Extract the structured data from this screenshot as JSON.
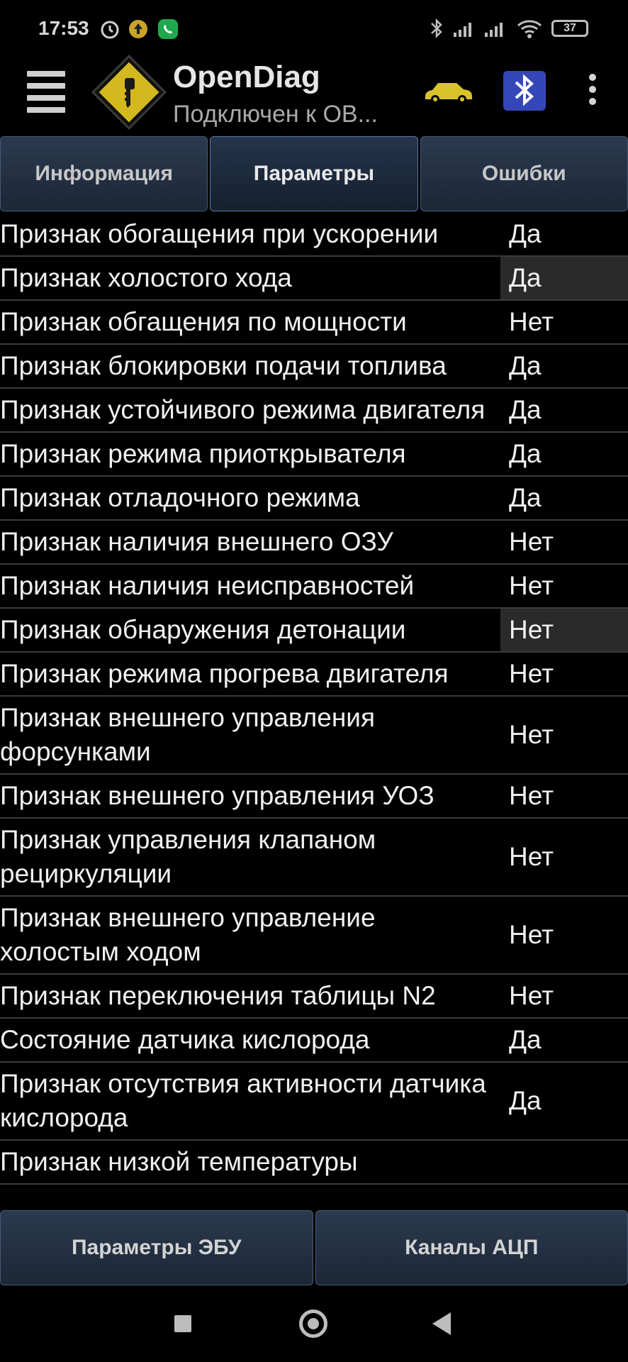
{
  "status_bar": {
    "time": "17:53",
    "battery": "37",
    "icons": [
      "alarm-icon",
      "notification-app-icon",
      "whatsapp-icon",
      "bluetooth-icon",
      "signal-icon",
      "signal-icon",
      "wifi-icon",
      "battery-icon"
    ]
  },
  "app": {
    "title": "OpenDiag",
    "subtitle": "Подключен к ОВ..."
  },
  "tabs": [
    {
      "label": "Информация"
    },
    {
      "label": "Параметры"
    },
    {
      "label": "Ошибки"
    }
  ],
  "params": [
    {
      "name": "Признак обогащения при ускорении",
      "value": "Да"
    },
    {
      "name": "Признак холостого хода",
      "value": "Да"
    },
    {
      "name": "Признак обгащения по мощности",
      "value": "Нет"
    },
    {
      "name": "Признак блокировки подачи топлива",
      "value": "Да"
    },
    {
      "name": "Признак устойчивого режима двигателя",
      "value": "Да"
    },
    {
      "name": "Признак режима приоткрывателя",
      "value": "Да"
    },
    {
      "name": "Признак отладочного режима",
      "value": "Да"
    },
    {
      "name": "Признак наличия внешнего ОЗУ",
      "value": "Нет"
    },
    {
      "name": "Признак наличия неисправностей",
      "value": "Нет"
    },
    {
      "name": "Признак обнаружения детонации",
      "value": "Нет"
    },
    {
      "name": "Признак режима прогрева двигателя",
      "value": "Нет"
    },
    {
      "name": "Признак внешнего управления форсунками",
      "value": "Нет"
    },
    {
      "name": "Признак внешнего управления УОЗ",
      "value": "Нет"
    },
    {
      "name": "Признак управления клапаном рециркуляции",
      "value": "Нет"
    },
    {
      "name": "Признак внешнего управление холостым ходом",
      "value": "Нет"
    },
    {
      "name": "Признак переключения таблицы N2",
      "value": "Нет"
    },
    {
      "name": "Состояние датчика кислорода",
      "value": "Да"
    },
    {
      "name": "Признак отсутствия активности датчика кислорода",
      "value": "Да"
    },
    {
      "name": "Признак низкой температуры",
      "value": ""
    }
  ],
  "bottom_buttons": [
    {
      "label": "Параметры ЭБУ"
    },
    {
      "label": "Каналы АЦП"
    }
  ],
  "colors": {
    "background": "#000000",
    "tab_bg": "#22303f",
    "tab_border": "#465a76",
    "divider": "#3b3b3b",
    "accent_car": "#d9c32a"
  }
}
